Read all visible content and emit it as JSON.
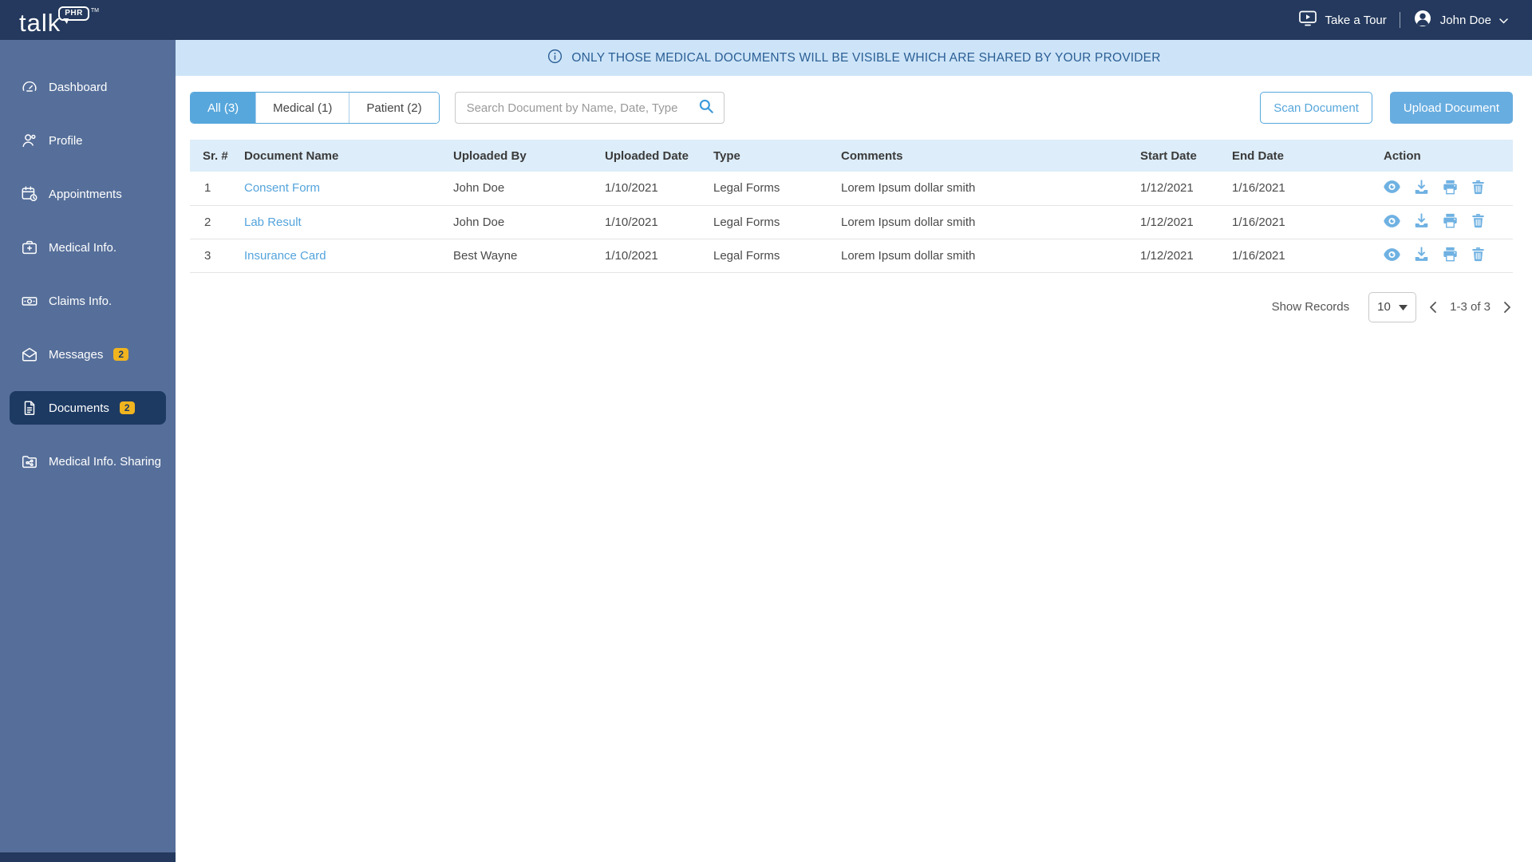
{
  "topbar": {
    "logo": {
      "word": "talk",
      "bubble": "PHR",
      "tm": "TM"
    },
    "take_a_tour_label": "Take a Tour",
    "user_name": "John Doe"
  },
  "sidebar": {
    "items": [
      {
        "label": "Dashboard",
        "icon": "dashboard-gauge-icon",
        "badge": "",
        "active": false
      },
      {
        "label": "Profile",
        "icon": "profile-person-icon",
        "badge": "",
        "active": false
      },
      {
        "label": "Appointments",
        "icon": "calendar-clock-icon",
        "badge": "",
        "active": false
      },
      {
        "label": "Medical Info.",
        "icon": "medical-case-plus-icon",
        "badge": "",
        "active": false
      },
      {
        "label": "Claims Info.",
        "icon": "banknote-icon",
        "badge": "",
        "active": false
      },
      {
        "label": "Messages",
        "icon": "envelope-icon",
        "badge": "2",
        "active": false
      },
      {
        "label": "Documents",
        "icon": "document-icon",
        "badge": "2",
        "active": true
      },
      {
        "label": "Medical Info. Sharing",
        "icon": "folder-share-icon",
        "badge": "",
        "active": false
      }
    ]
  },
  "banner": {
    "icon": "info-circle-icon",
    "text": "ONLY THOSE MEDICAL DOCUMENTS WILL BE VISIBLE WHICH ARE SHARED BY YOUR PROVIDER"
  },
  "toolbar": {
    "tabs": [
      {
        "label": "All (3)",
        "active": true
      },
      {
        "label": "Medical (1)",
        "active": false
      },
      {
        "label": "Patient (2)",
        "active": false
      }
    ],
    "search_placeholder": "Search Document by Name, Date, Type",
    "search_value": "",
    "search_icon": "search-icon",
    "scan_label": "Scan Document",
    "upload_label": "Upload Document"
  },
  "table": {
    "headers": [
      "Sr. #",
      "Document Name",
      "Uploaded By",
      "Uploaded Date",
      "Type",
      "Comments",
      "Start Date",
      "End Date",
      "Action"
    ],
    "action_icons": [
      "view-eye-icon",
      "download-icon",
      "print-icon",
      "delete-trash-icon"
    ],
    "rows": [
      {
        "sr": "1",
        "document_name": "Consent Form",
        "uploaded_by": "John Doe",
        "uploaded_date": "1/10/2021",
        "type": "Legal Forms",
        "comments": "Lorem Ipsum dollar smith",
        "start_date": "1/12/2021",
        "end_date": "1/16/2021"
      },
      {
        "sr": "2",
        "document_name": "Lab Result",
        "uploaded_by": "John Doe",
        "uploaded_date": "1/10/2021",
        "type": "Legal Forms",
        "comments": "Lorem Ipsum dollar smith",
        "start_date": "1/12/2021",
        "end_date": "1/16/2021"
      },
      {
        "sr": "3",
        "document_name": "Insurance Card",
        "uploaded_by": "Best Wayne",
        "uploaded_date": "1/10/2021",
        "type": "Legal Forms",
        "comments": "Lorem Ipsum dollar smith",
        "start_date": "1/12/2021",
        "end_date": "1/16/2021"
      }
    ]
  },
  "pagination": {
    "show_records_label": "Show Records",
    "page_size": "10",
    "range_label": "1-3 of 3"
  },
  "colors": {
    "topbar": "#24395d",
    "sidebar": "#566f9a",
    "active_item": "#1d3a63",
    "badge": "#f0b41f",
    "banner_bg": "#cde4f8",
    "banner_text": "#2b5f95",
    "accent": "#57a7dc",
    "upload": "#68ade0",
    "link": "#54a4dc",
    "icon_blue": "#6fb1e2",
    "header_bg": "#ddedf9"
  }
}
